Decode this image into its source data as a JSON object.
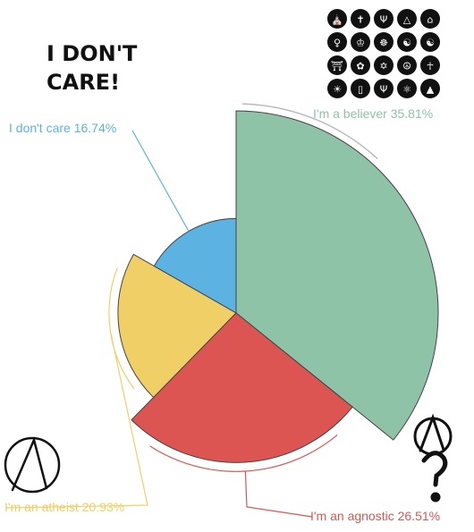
{
  "image_text": {
    "sticker_line1": "I DON'T",
    "sticker_line2": "CARE!"
  },
  "icons": {
    "atheist_left": "atheist-a-symbol",
    "agnostic_right": "agnostic-a-question-symbol",
    "religion_grid": [
      "church",
      "cross",
      "trident",
      "pyramid",
      "temple",
      "figure",
      "crown",
      "dharma-wheel",
      "meditation",
      "yin-yang",
      "torii",
      "lotus",
      "star-of-david",
      "peace",
      "ankh",
      "sun",
      "tablet",
      "menorah",
      "atom",
      "triangle-hand"
    ]
  },
  "chart_data": {
    "type": "pie",
    "style": "polar-area (radius varies by value)",
    "slices": [
      {
        "label": "I'm a believer",
        "value": 35.81,
        "display": "I'm a believer 35.81%",
        "color": "#8ec3a8"
      },
      {
        "label": "I'm an agnostic",
        "value": 26.51,
        "display": "I'm an agnostic 26.51%",
        "color": "#dd5553"
      },
      {
        "label": "I'm an atheist",
        "value": 20.93,
        "display": "I'm an atheist 20.93%",
        "color": "#f1cf67"
      },
      {
        "label": "I don't care",
        "value": 16.74,
        "display": "I don't care 16.74%",
        "color": "#5cb3e2"
      }
    ],
    "legend": "none",
    "grid": false
  }
}
